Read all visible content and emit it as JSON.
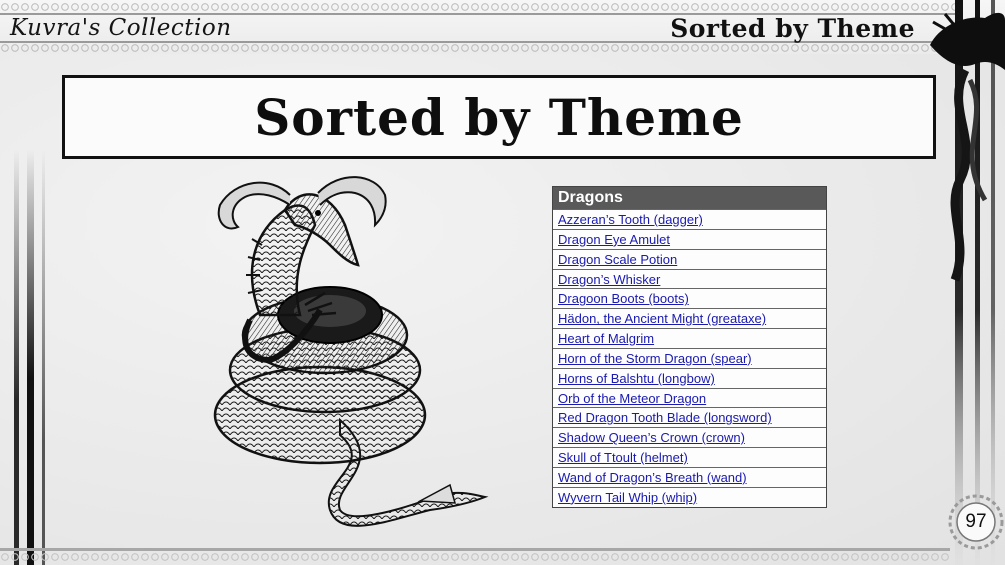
{
  "header": {
    "left_title": "Kuvra's Collection",
    "right_title": "Sorted by Theme"
  },
  "main": {
    "title": "Sorted by Theme"
  },
  "table": {
    "heading": "Dragons",
    "items": [
      "Azzeran’s Tooth (dagger)",
      "Dragon Eye Amulet",
      "Dragon Scale Potion",
      "Dragon’s Whisker",
      "Dragoon Boots (boots)",
      "Hädon, the Ancient Might (greataxe)",
      "Heart of Malgrim",
      "Horn of the Storm Dragon (spear)",
      "Horns of Balshtu (longbow)",
      "Orb of the Meteor Dragon",
      "Red Dragon Tooth Blade (longsword)",
      "Shadow Queen’s Crown (crown)",
      "Skull of Ttoult (helmet)",
      "Wand of Dragon’s Breath (wand)",
      "Wyvern Tail Whip (whip)"
    ]
  },
  "footer": {
    "page_number": "97"
  },
  "icons": {
    "illustration": "coiled-dragon-illustration",
    "border": "dragon-border-ornament",
    "badge": "ornate-page-badge"
  },
  "colors": {
    "ink": "#111111",
    "link": "#1a1ab0",
    "table_header": "#595959",
    "paper": "#ededed"
  }
}
